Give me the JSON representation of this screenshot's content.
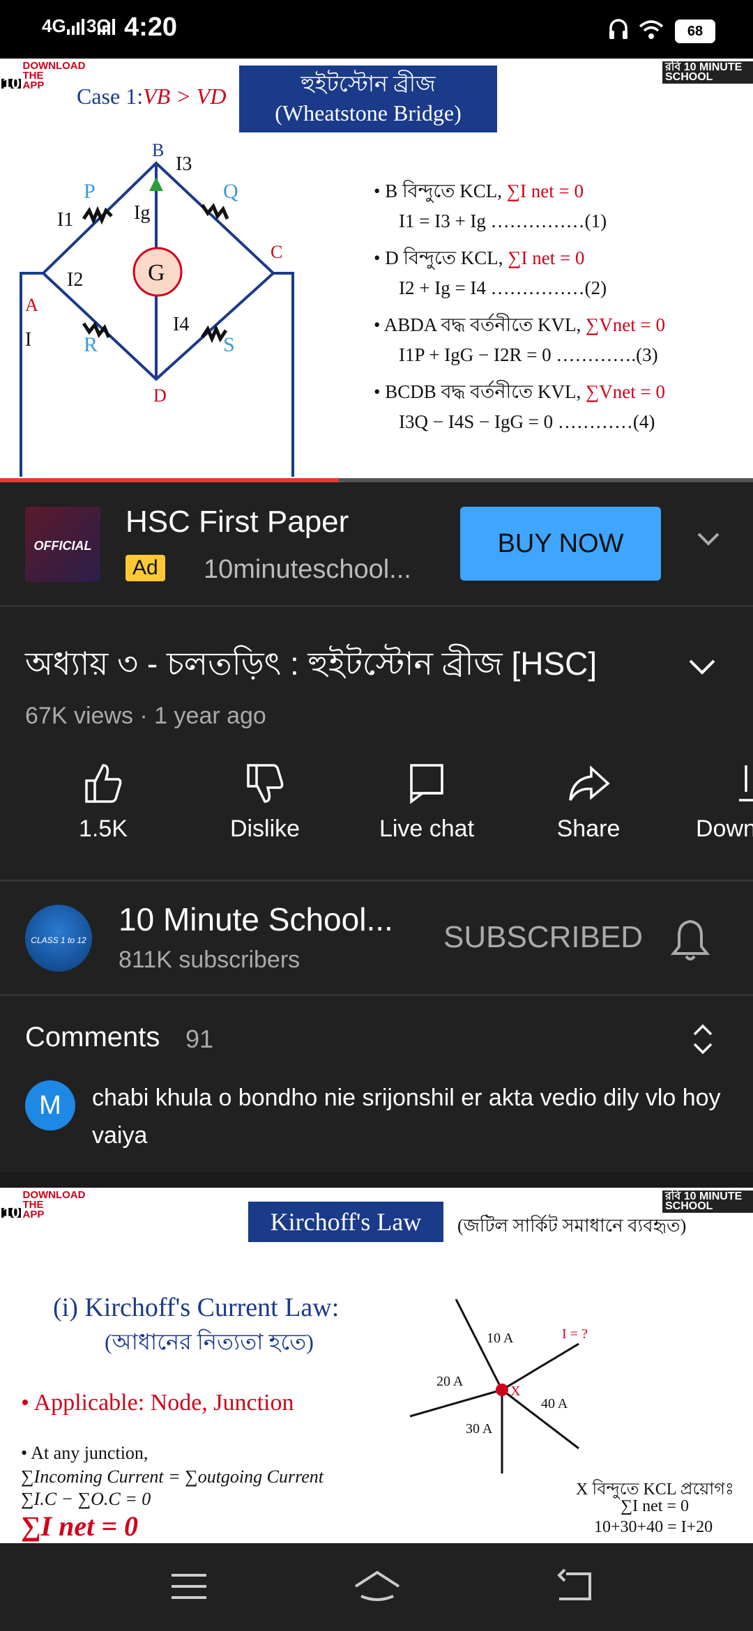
{
  "status_bar": {
    "network1": "4G",
    "network2": "3G",
    "time": "4:20",
    "battery": "68"
  },
  "video_frame": {
    "download_badge": "DOWNLOAD THE APP",
    "ten": "10",
    "brand": "রবি 10 MINUTE SCHOOL",
    "case_label": "Case 1:",
    "case_expr": "VB > VD",
    "title_bn": "হুইটস্টোন ব্রীজ",
    "title_en": "(Wheatstone Bridge)",
    "node_labels": [
      "B",
      "A",
      "C",
      "D"
    ],
    "resistor_labels": [
      "P",
      "Q",
      "R",
      "S"
    ],
    "current_labels": [
      "I3",
      "I1",
      "Ig",
      "I2",
      "I4",
      "I",
      "G"
    ],
    "equations": [
      {
        "bullet": true,
        "text": "B বিন্দুতে KCL, ",
        "red": "∑I net = 0"
      },
      {
        "bullet": false,
        "text": "I1 = I3 + Ig ……………(1)",
        "red": ""
      },
      {
        "bullet": true,
        "text": "D বিন্দুতে KCL, ",
        "red": "∑I net = 0"
      },
      {
        "bullet": false,
        "text": "I2 + Ig = I4 ……………(2)",
        "red": ""
      },
      {
        "bullet": true,
        "text": "ABDA বদ্ধ বর্তনীতে KVL, ",
        "red": "∑Vnet = 0"
      },
      {
        "bullet": false,
        "text": "I1P + IgG − I2R = 0 ………….(3)",
        "red": ""
      },
      {
        "bullet": true,
        "text": "BCDB বদ্ধ বর্তনীতে KVL, ",
        "red": "∑Vnet = 0"
      },
      {
        "bullet": false,
        "text": "I3Q − I4S − IgG = 0 …………(4)",
        "red": ""
      }
    ],
    "progress": 0.45
  },
  "ad": {
    "thumb_text": "OFFICIAL",
    "title": "HSC First Paper",
    "label": "Ad",
    "channel": "10minuteschool...",
    "button": "BUY NOW"
  },
  "video": {
    "title": "অধ্যায় ৩ - চলতড়িৎ : হুইটস্টোন ব্রীজ [HSC]",
    "meta": "67K views · 1 year ago"
  },
  "actions": [
    {
      "label": "1.5K",
      "icon": "like-icon"
    },
    {
      "label": "Dislike",
      "icon": "dislike-icon"
    },
    {
      "label": "Live chat",
      "icon": "live-chat-icon"
    },
    {
      "label": "Share",
      "icon": "share-icon"
    },
    {
      "label": "Down",
      "icon": "download-icon"
    }
  ],
  "channel": {
    "avatar_text": "CLASS 1 to 12",
    "name": "10 Minute School...",
    "subscribers": "811K subscribers",
    "subscribe_state": "SUBSCRIBED"
  },
  "comments": {
    "title": "Comments",
    "count": "91",
    "first": {
      "avatar": "M",
      "text": "chabi khula o bondho nie srijonshil er akta vedio dily vlo hoy vaiya"
    }
  },
  "next_video": {
    "download_badge": "DOWNLOAD THE APP",
    "ten": "10",
    "brand": "রবি 10 MINUTE SCHOOL",
    "title": "Kirchoff's Law",
    "subtitle": "(জটিল সার্কিট সমাধানে ব্যবহৃত)",
    "heading": "(i) Kirchoff's Current Law:",
    "heading_bn": "(আধানের নিত্যতা হতে)",
    "applicable": "Applicable: Node, Junction",
    "at_junction": "At any junction,",
    "formula1": "∑Incoming Current = ∑outgoing Current",
    "formula2": "∑I.C − ∑O.C = 0",
    "formula3": "∑I net = 0",
    "currents": [
      "10 A",
      "I = ?",
      "20 A",
      "X",
      "40 A",
      "30 A"
    ],
    "kcl_label": "X বিন্দুতে KCL প্রয়োগঃ",
    "kcl_formula": "∑I net = 0",
    "kcl_sum": "10+30+40 = I+20"
  },
  "navbar": {
    "buttons": [
      "menu-icon",
      "home-icon",
      "back-icon"
    ]
  }
}
